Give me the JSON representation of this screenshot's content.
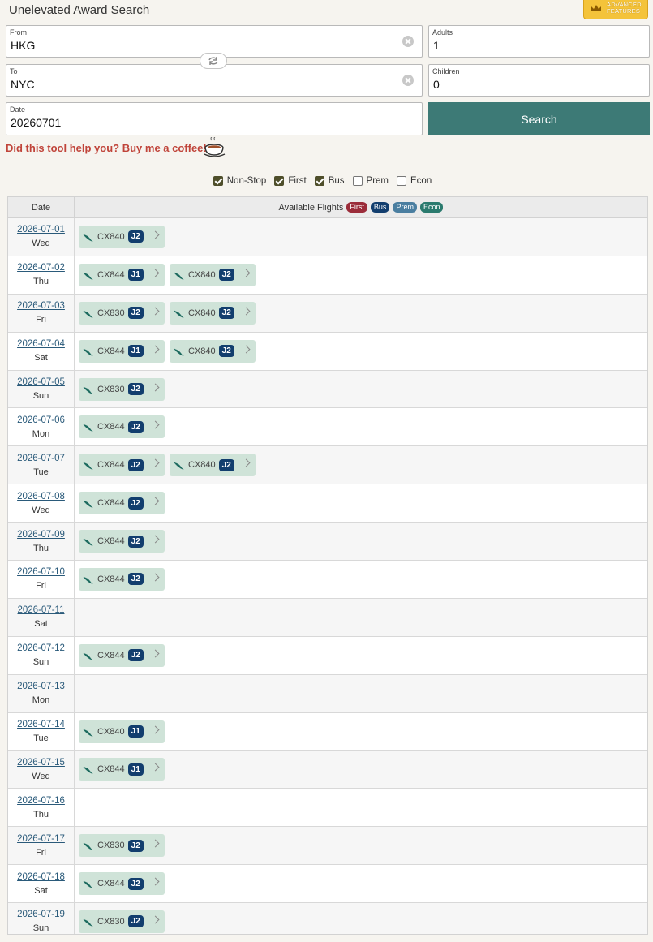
{
  "app": {
    "title": "Unelevated Award Search"
  },
  "advanced": {
    "label_line1": "ADVANCED",
    "label_line2": "FEATURES",
    "icon": "crown-icon"
  },
  "form": {
    "from": {
      "label": "From",
      "value": "HKG"
    },
    "to": {
      "label": "To",
      "value": "NYC"
    },
    "date": {
      "label": "Date",
      "value": "20260701"
    },
    "adults": {
      "label": "Adults",
      "value": "1"
    },
    "children": {
      "label": "Children",
      "value": "0"
    },
    "search_label": "Search",
    "swap_icon": "swap-icon"
  },
  "coffee": {
    "text": "Did this tool help you? Buy me a coffee!",
    "icon": "coffee-cup-icon"
  },
  "filters": [
    {
      "label": "Non-Stop",
      "checked": true
    },
    {
      "label": "First",
      "checked": true
    },
    {
      "label": "Bus",
      "checked": true
    },
    {
      "label": "Prem",
      "checked": false
    },
    {
      "label": "Econ",
      "checked": false
    }
  ],
  "table": {
    "col_date": "Date",
    "col_flights": "Available Flights",
    "badges": [
      {
        "label": "First",
        "color": "#9b2c3a"
      },
      {
        "label": "Bus",
        "color": "#123e6e"
      },
      {
        "label": "Prem",
        "color": "#4a7ea0"
      },
      {
        "label": "Econ",
        "color": "#2a7a6e"
      }
    ],
    "rows": [
      {
        "date": "2026-07-01",
        "day": "Wed",
        "flights": [
          {
            "no": "CX840",
            "cls": "J2"
          }
        ]
      },
      {
        "date": "2026-07-02",
        "day": "Thu",
        "flights": [
          {
            "no": "CX844",
            "cls": "J1"
          },
          {
            "no": "CX840",
            "cls": "J2"
          }
        ]
      },
      {
        "date": "2026-07-03",
        "day": "Fri",
        "flights": [
          {
            "no": "CX830",
            "cls": "J2"
          },
          {
            "no": "CX840",
            "cls": "J2"
          }
        ]
      },
      {
        "date": "2026-07-04",
        "day": "Sat",
        "flights": [
          {
            "no": "CX844",
            "cls": "J1"
          },
          {
            "no": "CX840",
            "cls": "J2"
          }
        ]
      },
      {
        "date": "2026-07-05",
        "day": "Sun",
        "flights": [
          {
            "no": "CX830",
            "cls": "J2"
          }
        ]
      },
      {
        "date": "2026-07-06",
        "day": "Mon",
        "flights": [
          {
            "no": "CX844",
            "cls": "J2"
          }
        ]
      },
      {
        "date": "2026-07-07",
        "day": "Tue",
        "flights": [
          {
            "no": "CX844",
            "cls": "J2"
          },
          {
            "no": "CX840",
            "cls": "J2"
          }
        ]
      },
      {
        "date": "2026-07-08",
        "day": "Wed",
        "flights": [
          {
            "no": "CX844",
            "cls": "J2"
          }
        ]
      },
      {
        "date": "2026-07-09",
        "day": "Thu",
        "flights": [
          {
            "no": "CX844",
            "cls": "J2"
          }
        ]
      },
      {
        "date": "2026-07-10",
        "day": "Fri",
        "flights": [
          {
            "no": "CX844",
            "cls": "J2"
          }
        ]
      },
      {
        "date": "2026-07-11",
        "day": "Sat",
        "flights": []
      },
      {
        "date": "2026-07-12",
        "day": "Sun",
        "flights": [
          {
            "no": "CX844",
            "cls": "J2"
          }
        ]
      },
      {
        "date": "2026-07-13",
        "day": "Mon",
        "flights": []
      },
      {
        "date": "2026-07-14",
        "day": "Tue",
        "flights": [
          {
            "no": "CX840",
            "cls": "J1"
          }
        ]
      },
      {
        "date": "2026-07-15",
        "day": "Wed",
        "flights": [
          {
            "no": "CX844",
            "cls": "J1"
          }
        ]
      },
      {
        "date": "2026-07-16",
        "day": "Thu",
        "flights": []
      },
      {
        "date": "2026-07-17",
        "day": "Fri",
        "flights": [
          {
            "no": "CX830",
            "cls": "J2"
          }
        ]
      },
      {
        "date": "2026-07-18",
        "day": "Sat",
        "flights": [
          {
            "no": "CX844",
            "cls": "J2"
          }
        ]
      },
      {
        "date": "2026-07-19",
        "day": "Sun",
        "flights": [
          {
            "no": "CX830",
            "cls": "J2"
          }
        ]
      }
    ]
  },
  "colors": {
    "accent": "#3d7a76",
    "flight_bg": "#cfe3d8",
    "class_badge": "#123e6e",
    "link": "#c0443a"
  }
}
